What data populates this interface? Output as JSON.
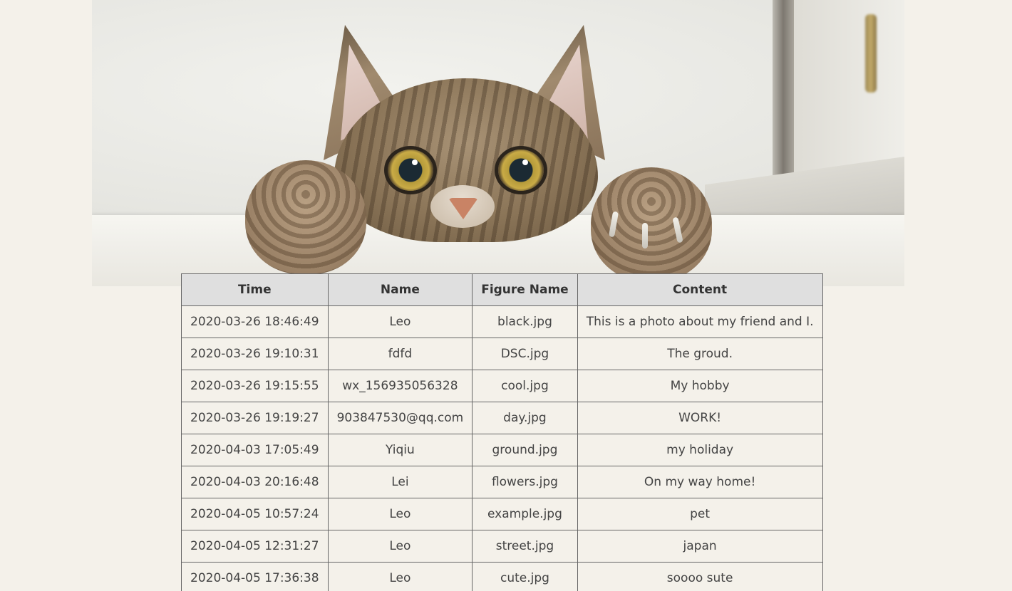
{
  "banner": {
    "image": "cat-peeking-photo"
  },
  "table": {
    "headers": {
      "time": "Time",
      "name": "Name",
      "figure_name": "Figure Name",
      "content": "Content"
    },
    "rows": [
      {
        "time": "2020-03-26 18:46:49",
        "name": "Leo",
        "figure_name": "black.jpg",
        "content": "This is a photo about my friend and I."
      },
      {
        "time": "2020-03-26 19:10:31",
        "name": "fdfd",
        "figure_name": "DSC.jpg",
        "content": "The groud."
      },
      {
        "time": "2020-03-26 19:15:55",
        "name": "wx_156935056328",
        "figure_name": "cool.jpg",
        "content": "My hobby"
      },
      {
        "time": "2020-03-26 19:19:27",
        "name": "903847530@qq.com",
        "figure_name": "day.jpg",
        "content": "WORK!"
      },
      {
        "time": "2020-04-03 17:05:49",
        "name": "Yiqiu",
        "figure_name": "ground.jpg",
        "content": "my holiday"
      },
      {
        "time": "2020-04-03 20:16:48",
        "name": "Lei",
        "figure_name": "flowers.jpg",
        "content": "On my way home!"
      },
      {
        "time": "2020-04-05 10:57:24",
        "name": "Leo",
        "figure_name": "example.jpg",
        "content": "pet"
      },
      {
        "time": "2020-04-05 12:31:27",
        "name": "Leo",
        "figure_name": "street.jpg",
        "content": "japan"
      },
      {
        "time": "2020-04-05 17:36:38",
        "name": "Leo",
        "figure_name": "cute.jpg",
        "content": "soooo sute"
      }
    ]
  }
}
